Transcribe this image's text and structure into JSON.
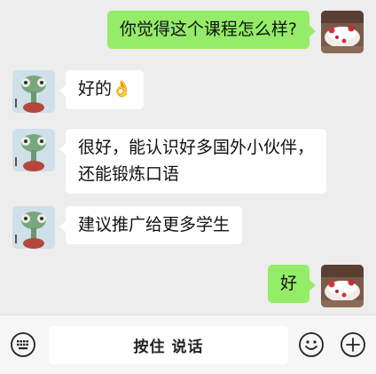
{
  "messages": [
    {
      "side": "out",
      "lines": [
        "你觉得这个课程怎么样?"
      ],
      "avatar": "dessert-avatar"
    },
    {
      "side": "in",
      "lines": [
        "好的"
      ],
      "emoji": "👌",
      "avatar": "chameleon-avatar"
    },
    {
      "side": "in",
      "lines": [
        "很好，能认识好多国外小伙伴，",
        "还能锻炼口语"
      ],
      "avatar": "chameleon-avatar"
    },
    {
      "side": "in",
      "lines": [
        "建议推广给更多学生"
      ],
      "avatar": "chameleon-avatar"
    },
    {
      "side": "out",
      "lines": [
        "好"
      ],
      "avatar": "dessert-avatar"
    }
  ],
  "input_bar": {
    "hold_to_talk_label": "按住 说话",
    "left_icon": "keyboard-icon",
    "right_icons": [
      "emoji-icon",
      "plus-icon"
    ]
  },
  "colors": {
    "background": "#ededed",
    "outgoing_bubble": "#95ec69",
    "incoming_bubble": "#ffffff",
    "input_bar": "#f6f6f6"
  }
}
